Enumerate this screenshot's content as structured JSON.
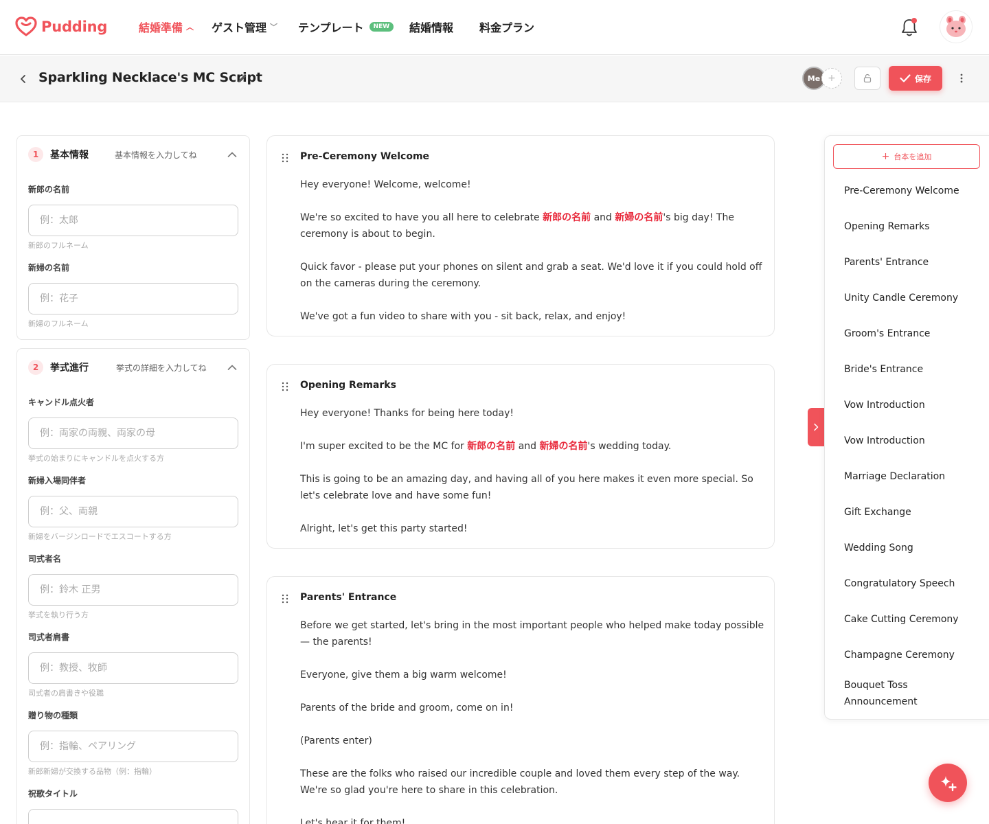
{
  "brand": {
    "name": "Pudding",
    "color": "#f0535a"
  },
  "nav": {
    "items": [
      {
        "label": "結婚準備",
        "active": true,
        "dropdown": true
      },
      {
        "label": "ゲスト管理",
        "dropdown": true
      },
      {
        "label": "テンプレート",
        "badge": "NEW"
      },
      {
        "label": "結婚情報"
      },
      {
        "label": "料金プラン"
      }
    ]
  },
  "header": {
    "title": "Sparkling Necklace's MC Script",
    "me_label": "Me",
    "save_label": "保存"
  },
  "form": {
    "sections": [
      {
        "num": "1",
        "title": "基本情報",
        "hint": "基本情報を入力してね",
        "fields": [
          {
            "label": "新郎の名前",
            "placeholder": "例：太郎",
            "help": "新郎のフルネーム"
          },
          {
            "label": "新婦の名前",
            "placeholder": "例：花子",
            "help": "新婦のフルネーム"
          }
        ]
      },
      {
        "num": "2",
        "title": "挙式進行",
        "hint": "挙式の詳細を入力してね",
        "fields": [
          {
            "label": "キャンドル点火者",
            "placeholder": "例：両家の両親、両家の母",
            "help": "挙式の始まりにキャンドルを点火する方"
          },
          {
            "label": "新婦入場同伴者",
            "placeholder": "例：父、両親",
            "help": "新婦をバージンロードでエスコートする方"
          },
          {
            "label": "司式者名",
            "placeholder": "例：鈴木 正男",
            "help": "挙式を執り行う方"
          },
          {
            "label": "司式者肩書",
            "placeholder": "例：教授、牧師",
            "help": "司式者の肩書きや役職"
          },
          {
            "label": "贈り物の種類",
            "placeholder": "例：指輪、ペアリング",
            "help": "新郎新婦が交換する品物（例：指輪）"
          },
          {
            "label": "祝歌タイトル"
          }
        ]
      }
    ]
  },
  "scripts": {
    "groom_var": "新郎の名前",
    "bride_var": "新婦の名前",
    "cards": [
      {
        "title": "Pre-Ceremony Welcome",
        "p1": "Hey everyone! Welcome, welcome!",
        "p2_a": "We're so excited to have you all here to celebrate ",
        "p2_b": " and ",
        "p2_c": "'s big day! The ceremony is about to begin.",
        "p3": "Quick favor - please put your phones on silent and grab a seat. We'd love it if you could hold off on the cameras during the ceremony.",
        "p4": "We've got a fun video to share with you - sit back, relax, and enjoy!"
      },
      {
        "title": "Opening Remarks",
        "p1": "Hey everyone! Thanks for being here today!",
        "p2_a": "I'm super excited to be the MC for ",
        "p2_b": " and ",
        "p2_c": "'s wedding today.",
        "p3": "This is going to be an amazing day, and having all of you here makes it even more special. So let's celebrate love and have some fun!",
        "p4": "Alright, let's get this party started!"
      },
      {
        "title": "Parents' Entrance",
        "p1": "Before we get started, let's bring in the most important people who helped make today possible — the parents!",
        "p2": "Everyone, give them a big warm welcome!",
        "p3": "Parents of the bride and groom, come on in!",
        "p4": "(Parents enter)",
        "p5": "These are the folks who raised our incredible couple and loved them every step of the way. We're so glad you're here to share in this celebration.",
        "p6": "Let's hear it for them!"
      }
    ]
  },
  "outline": {
    "add_label": "台本を追加",
    "items": [
      "Pre-Ceremony Welcome",
      "Opening Remarks",
      "Parents' Entrance",
      "Unity Candle Ceremony",
      "Groom's Entrance",
      "Bride's Entrance",
      "Vow Introduction",
      "Vow Introduction",
      "Marriage Declaration",
      "Gift Exchange",
      "Wedding Song",
      "Congratulatory Speech",
      "Cake Cutting Ceremony",
      "Champagne Ceremony",
      "Bouquet Toss Announcement"
    ]
  }
}
